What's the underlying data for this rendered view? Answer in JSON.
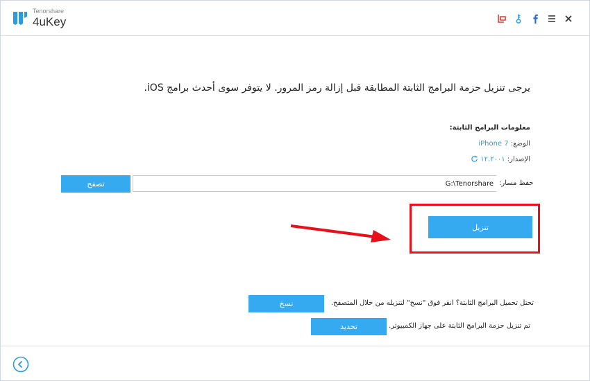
{
  "app": {
    "brand_small": "Tenorshare",
    "brand_name": "4uKey"
  },
  "titlebar_icons": [
    "cart-icon",
    "key-icon",
    "facebook-icon",
    "menu-icon",
    "close-icon"
  ],
  "intro_text": "يرجى تنزيل حزمة البرامج الثابتة المطابقة قبل إزالة رمز المرور. لا يتوفر سوى أحدث برامج iOS.",
  "firmware": {
    "title": "معلومات البرامج الثابتة:",
    "model_label": "الوضع:",
    "model_value": "iPhone 7",
    "version_label": "الإصدار:",
    "version_value": "١٢.٢٠٠١"
  },
  "path": {
    "label": "حفظ مسار:",
    "value": "G:\\Tenorshare",
    "browse_label": "تصفح"
  },
  "download_label": "تنزيل",
  "copy_row": {
    "text": "تحتل تحميل البرامج الثابتة؟ انقر فوق \"نسخ\" لتنزيله من خلال المتصفح.",
    "button_label": "نسخ"
  },
  "import_row": {
    "text": "تم تنزيل حزمة البرامج الثابتة على جهاز الكمبيوتر.",
    "button_label": "تحديد"
  },
  "colors": {
    "accent": "#36aaf0",
    "highlight": "#e8101a",
    "brand": "#2a9de0"
  }
}
